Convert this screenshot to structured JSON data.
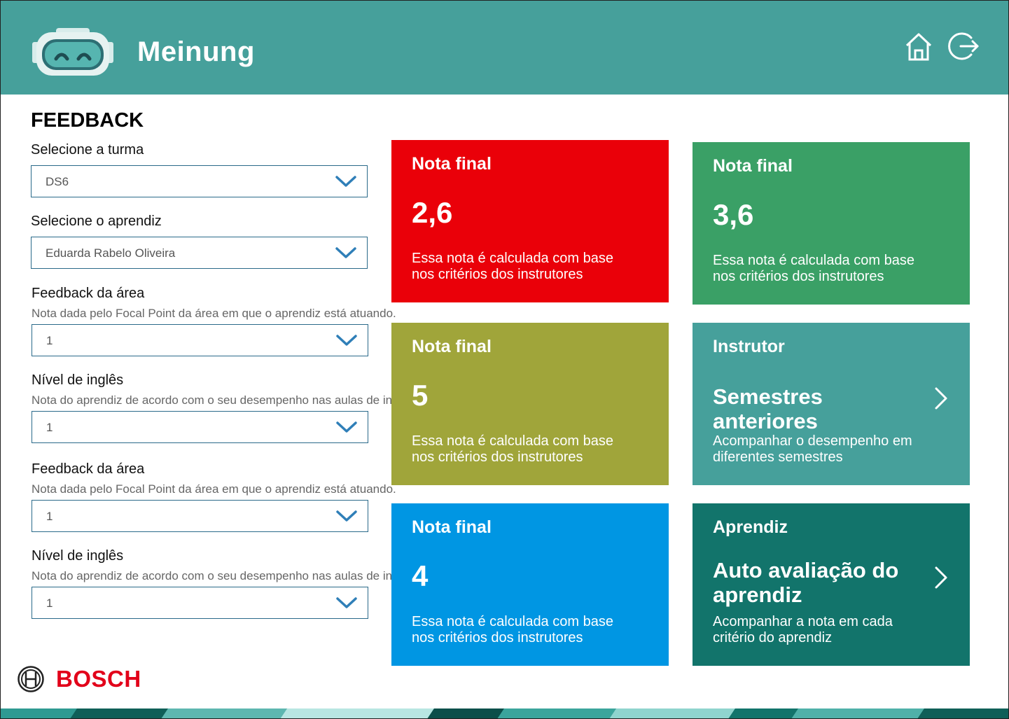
{
  "header": {
    "app_title": "Meinung",
    "icons": [
      "home-icon",
      "logout-icon"
    ],
    "color": "#46a09b"
  },
  "page": {
    "title": "FEEDBACK"
  },
  "form": {
    "turma": {
      "label": "Selecione a turma",
      "value": "DS6"
    },
    "aprendiz": {
      "label": "Selecione o aprendiz",
      "value": "Eduarda Rabelo Oliveira"
    },
    "fields": [
      {
        "label": "Feedback da área",
        "sub": "Nota dada pelo Focal Point da área em que o aprendiz está atuando.",
        "value": "1"
      },
      {
        "label": "Nível de inglês",
        "sub": "Nota do aprendiz de acordo com o seu desempenho nas aulas de inglês.",
        "value": "1"
      },
      {
        "label": "Feedback da área",
        "sub": "Nota dada pelo Focal Point da área em que o aprendiz está atuando.",
        "value": "1"
      },
      {
        "label": "Nível de inglês",
        "sub": "Nota do aprendiz de acordo com o seu desempenho nas aulas de inglês.",
        "value": "1"
      }
    ]
  },
  "cards": [
    {
      "title": "Nota final",
      "value": "2,6",
      "desc": "Essa nota é calculada com base nos critérios dos instrutores",
      "color": "#ea0009"
    },
    {
      "title": "Nota final",
      "value": "3,6",
      "desc": "Essa nota é calculada com base nos critérios dos instrutores",
      "color": "#3aa066"
    },
    {
      "title": "Nota final",
      "value": "5",
      "desc": "Essa nota é calculada com base nos critérios dos instrutores",
      "color": "#a0a53a"
    },
    {
      "title": "Instrutor",
      "heading": "Semestres anteriores",
      "desc": "Acompanhar o desempenho em diferentes semestres",
      "color": "#46a09b"
    },
    {
      "title": "Nota final",
      "value": "4",
      "desc": "Essa nota é calculada com base nos critérios dos instrutores",
      "color": "#0096e3"
    },
    {
      "title": "Aprendiz",
      "heading": "Auto avaliação do aprendiz",
      "desc": "Acompanhar a nota em cada critério do aprendiz",
      "color": "#12746b"
    }
  ],
  "footer": {
    "brand": "BOSCH",
    "brand_color": "#e2001a"
  }
}
